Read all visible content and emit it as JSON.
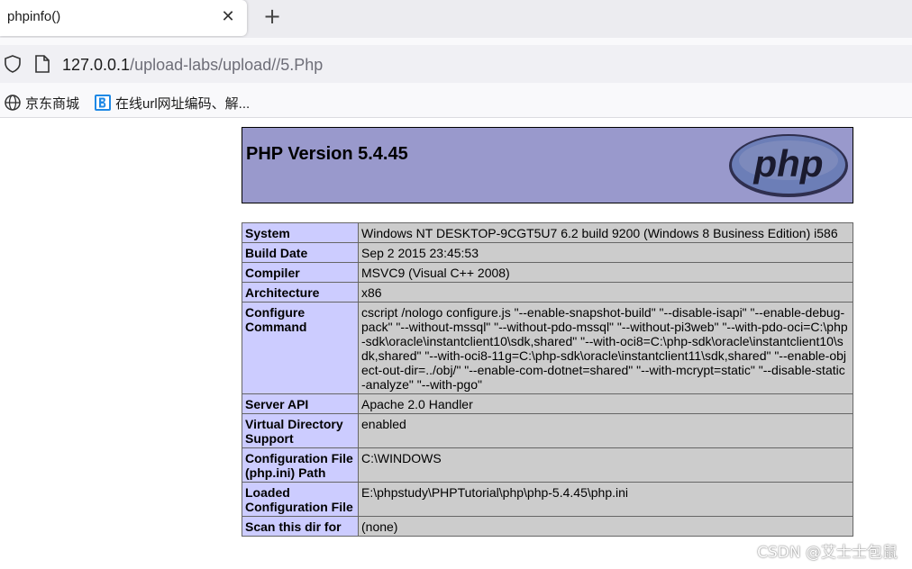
{
  "browser": {
    "tab_title": "phpinfo()",
    "close_glyph": "✕",
    "new_tab_glyph": "+",
    "url_host": "127.0.0.1",
    "url_path": "/upload-labs/upload//5.Php",
    "bookmarks": [
      {
        "label": "京东商城",
        "icon": "globe-icon"
      },
      {
        "label": "在线url网址编码、解...",
        "icon": "bookmark-b-icon"
      }
    ]
  },
  "phpinfo": {
    "title": "PHP Version 5.4.45",
    "logo_text": "php",
    "rows": [
      {
        "key": "System",
        "value": "Windows NT DESKTOP-9CGT5U7 6.2 build 9200 (Windows 8 Business Edition) i586"
      },
      {
        "key": "Build Date",
        "value": "Sep 2 2015 23:45:53"
      },
      {
        "key": "Compiler",
        "value": "MSVC9 (Visual C++ 2008)"
      },
      {
        "key": "Architecture",
        "value": "x86"
      },
      {
        "key": "Configure Command",
        "value": "cscript /nologo configure.js \"--enable-snapshot-build\" \"--disable-isapi\" \"--enable-debug-pack\" \"--without-mssql\" \"--without-pdo-mssql\" \"--without-pi3web\" \"--with-pdo-oci=C:\\php-sdk\\oracle\\instantclient10\\sdk,shared\" \"--with-oci8=C:\\php-sdk\\oracle\\instantclient10\\sdk,shared\" \"--with-oci8-11g=C:\\php-sdk\\oracle\\instantclient11\\sdk,shared\" \"--enable-object-out-dir=../obj/\" \"--enable-com-dotnet=shared\" \"--with-mcrypt=static\" \"--disable-static-analyze\" \"--with-pgo\""
      },
      {
        "key": "Server API",
        "value": "Apache 2.0 Handler"
      },
      {
        "key": "Virtual Directory Support",
        "value": "enabled"
      },
      {
        "key": "Configuration File (php.ini) Path",
        "value": "C:\\WINDOWS"
      },
      {
        "key": "Loaded Configuration File",
        "value": "E:\\phpstudy\\PHPTutorial\\php\\php-5.4.45\\php.ini"
      },
      {
        "key": "Scan this dir for",
        "value": "(none)"
      }
    ]
  },
  "watermark": "CSDN @艾士士包鼠",
  "colors": {
    "header_bg": "#9999cc",
    "key_bg": "#ccccff",
    "value_bg": "#cccccc"
  }
}
